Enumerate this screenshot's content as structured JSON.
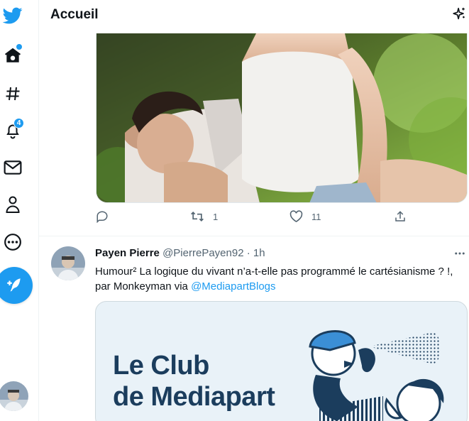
{
  "header": {
    "title": "Accueil"
  },
  "nav": {
    "notifications_badge": "4"
  },
  "tweet1": {
    "actions": {
      "reply_count": "",
      "retweet_count": "1",
      "like_count": "11"
    }
  },
  "tweet2": {
    "author_name": "Payen Pierre",
    "handle": "@PierrePayen92",
    "dot": "·",
    "time": "1h",
    "text_before_link": "Humour² La logique du vivant n’a-t-elle pas programmé le cartésianisme ? !, par Monkeyman via ",
    "link_text": "@MediapartBlogs",
    "card": {
      "line1": "Le Club",
      "line2": "de Mediapart"
    }
  },
  "colors": {
    "accent": "#1d9bf0",
    "text": "#0f1419",
    "muted": "#536471",
    "card_title": "#1b3d5d"
  }
}
